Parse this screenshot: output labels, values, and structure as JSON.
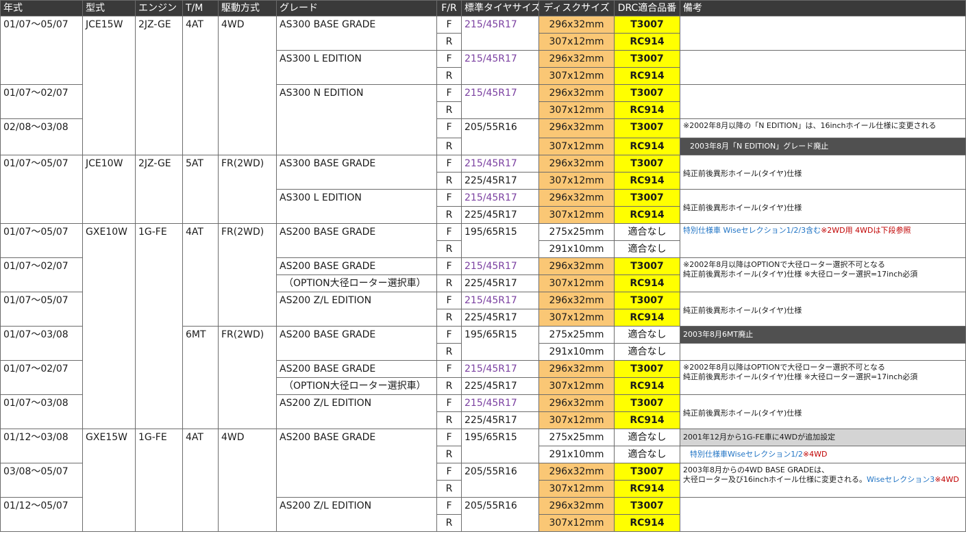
{
  "headers": {
    "year": "年式",
    "model": "型式",
    "engine": "エンジン",
    "tm": "T/M",
    "drive": "駆動方式",
    "grade": "グレード",
    "fr": "F/R",
    "tire": "標準タイヤサイズ",
    "disc": "ディスクサイズ",
    "drc": "DRC適合品番",
    "notes": "備考"
  },
  "years": [
    "01/07～05/07",
    "01/07～02/07",
    "02/08～03/08",
    "01/07～05/07",
    "01/07～05/07",
    "01/07～02/07",
    "01/07～05/07",
    "01/07～03/08",
    "01/07～02/07",
    "01/07～03/08",
    "01/12～03/08",
    "03/08～05/07",
    "01/12～05/07"
  ],
  "models": [
    "JCE15W",
    "JCE10W",
    "GXE10W",
    "GXE15W"
  ],
  "engines": [
    "2JZ-GE",
    "2JZ-GE",
    "1G-FE",
    "1G-FE"
  ],
  "tms": [
    "4AT",
    "5AT",
    "4AT",
    "6MT",
    "4AT"
  ],
  "drives": [
    "4WD",
    "FR(2WD)",
    "FR(2WD)",
    "FR(2WD)",
    "4WD"
  ],
  "grades": [
    "AS300 BASE GRADE",
    "AS300 L EDITION",
    "AS300 N EDITION",
    "AS300 BASE GRADE",
    "AS300 L EDITION",
    "AS200 BASE GRADE",
    "AS200 BASE GRADE",
    "（OPTION大径ローター選択車）",
    "AS200 Z/L EDITION",
    "AS200 BASE GRADE",
    "AS200 BASE GRADE",
    "（OPTION大径ローター選択車）",
    "AS200 Z/L EDITION",
    "AS200 BASE GRADE",
    "AS200 Z/L EDITION"
  ],
  "fr": {
    "f": "F",
    "r": "R"
  },
  "tires": [
    "215/45R17",
    "215/45R17",
    "215/45R17",
    "205/55R16",
    "215/45R17",
    "225/45R17",
    "215/45R17",
    "225/45R17",
    "195/65R15",
    "215/45R17",
    "225/45R17",
    "215/45R17",
    "225/45R17",
    "195/65R15",
    "215/45R17",
    "225/45R17",
    "215/45R17",
    "225/45R17",
    "195/65R15",
    "205/55R16",
    "205/55R16"
  ],
  "disc": {
    "f_large": "296x32mm",
    "r_large": "307x12mm",
    "f_small": "275x25mm",
    "r_small": "291x10mm"
  },
  "drc": {
    "f": "T3007",
    "r": "RC914",
    "none": "適合なし"
  },
  "notes": {
    "n1": "※2002年8月以降の「N EDITION」は、16inchホイール仕様に変更される",
    "n2": "2003年8月「N EDITION」グレード廃止",
    "n3": "純正前後異形ホイール(タイヤ)仕様",
    "n4a": "特別仕様車 Wiseセレクション1/2/3含む",
    "n4b": "※2WD用 4WDは下段参照",
    "n5": "※2002年8月以降はOPTIONで大径ローター選択不可となる",
    "n6": "純正前後異形ホイール(タイヤ)仕様 ※大径ローター選択=17inch必須",
    "n7": "2003年8月6MT廃止",
    "n8": "2001年12月から1G-FE車に4WDが追加設定",
    "n9a": "特別仕様車Wiseセレクション1/2",
    "n9b": "※4WD",
    "n10": "2003年8月からの4WD BASE GRADEは、",
    "n11a": "大径ローター及び16inchホイール仕様に変更される。",
    "n11b": "Wiseセレクション3",
    "n11c": "※4WD"
  }
}
